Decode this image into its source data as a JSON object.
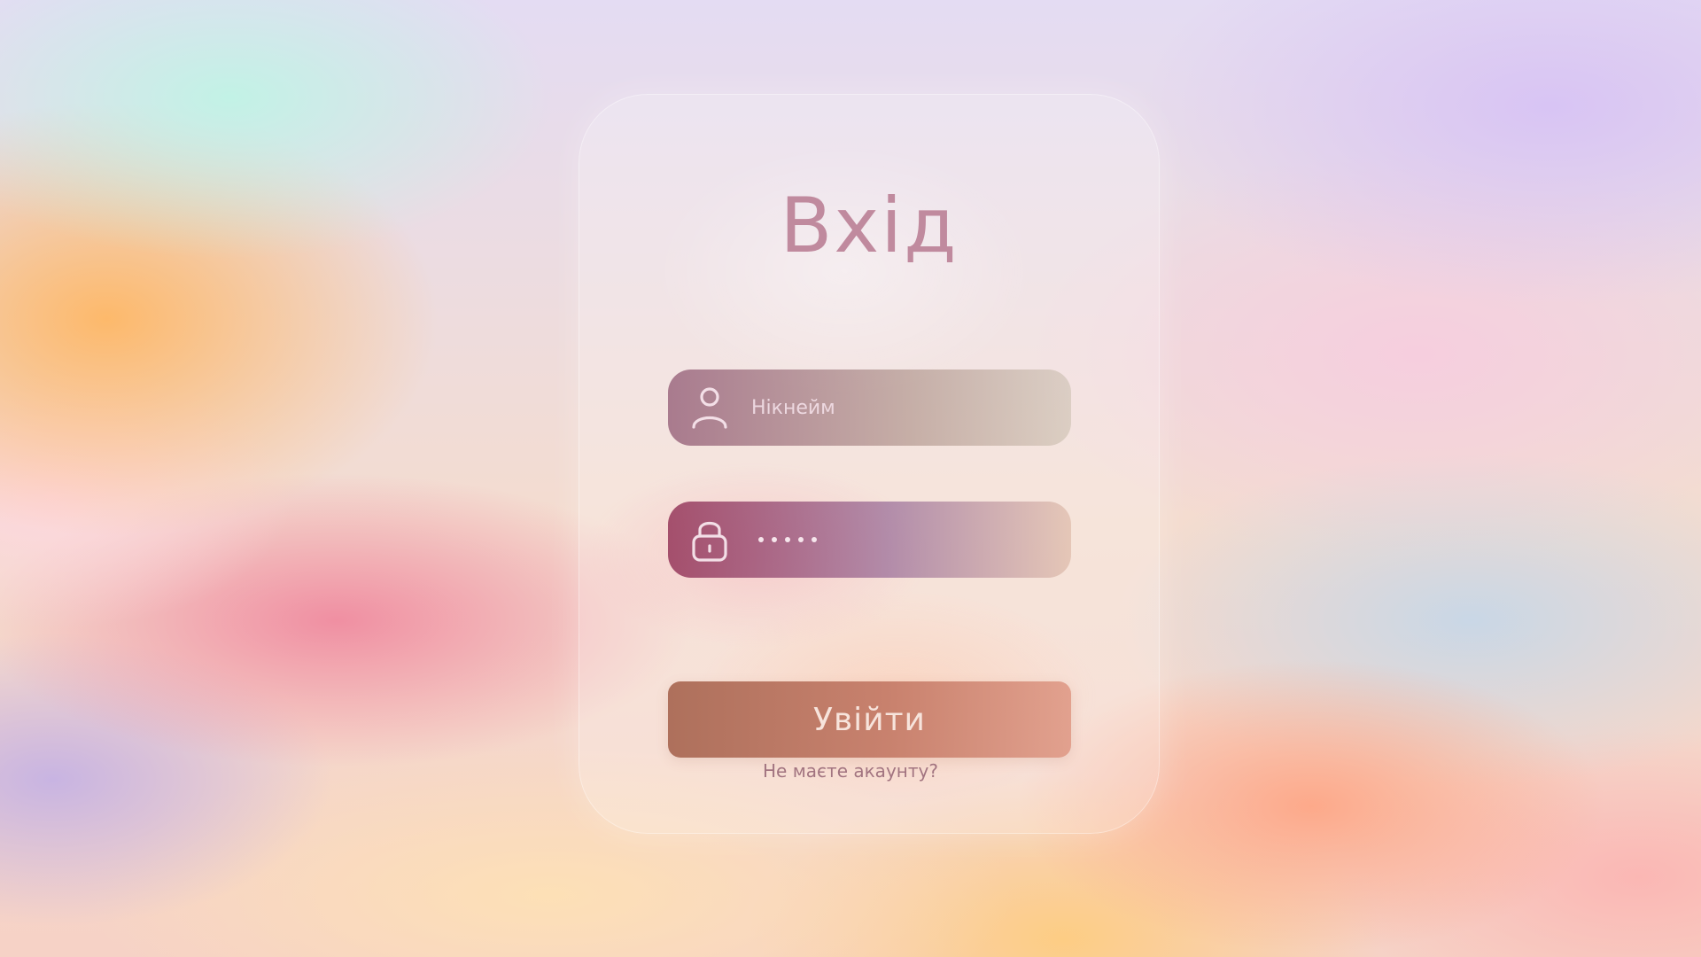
{
  "colors": {
    "title": "#c08a9e",
    "field_text": "#f2dde6",
    "button_bg": "#b8705a",
    "button_text": "#f7e4dc",
    "link_text": "#a27480"
  },
  "login": {
    "title": "Вхід",
    "username": {
      "icon": "user-icon",
      "placeholder": "Нікнейм",
      "value": ""
    },
    "password": {
      "icon": "lock-icon",
      "masked_length": 5
    },
    "submit_label": "Увійти",
    "signup_prompt": "Не маєте акаунту?"
  }
}
